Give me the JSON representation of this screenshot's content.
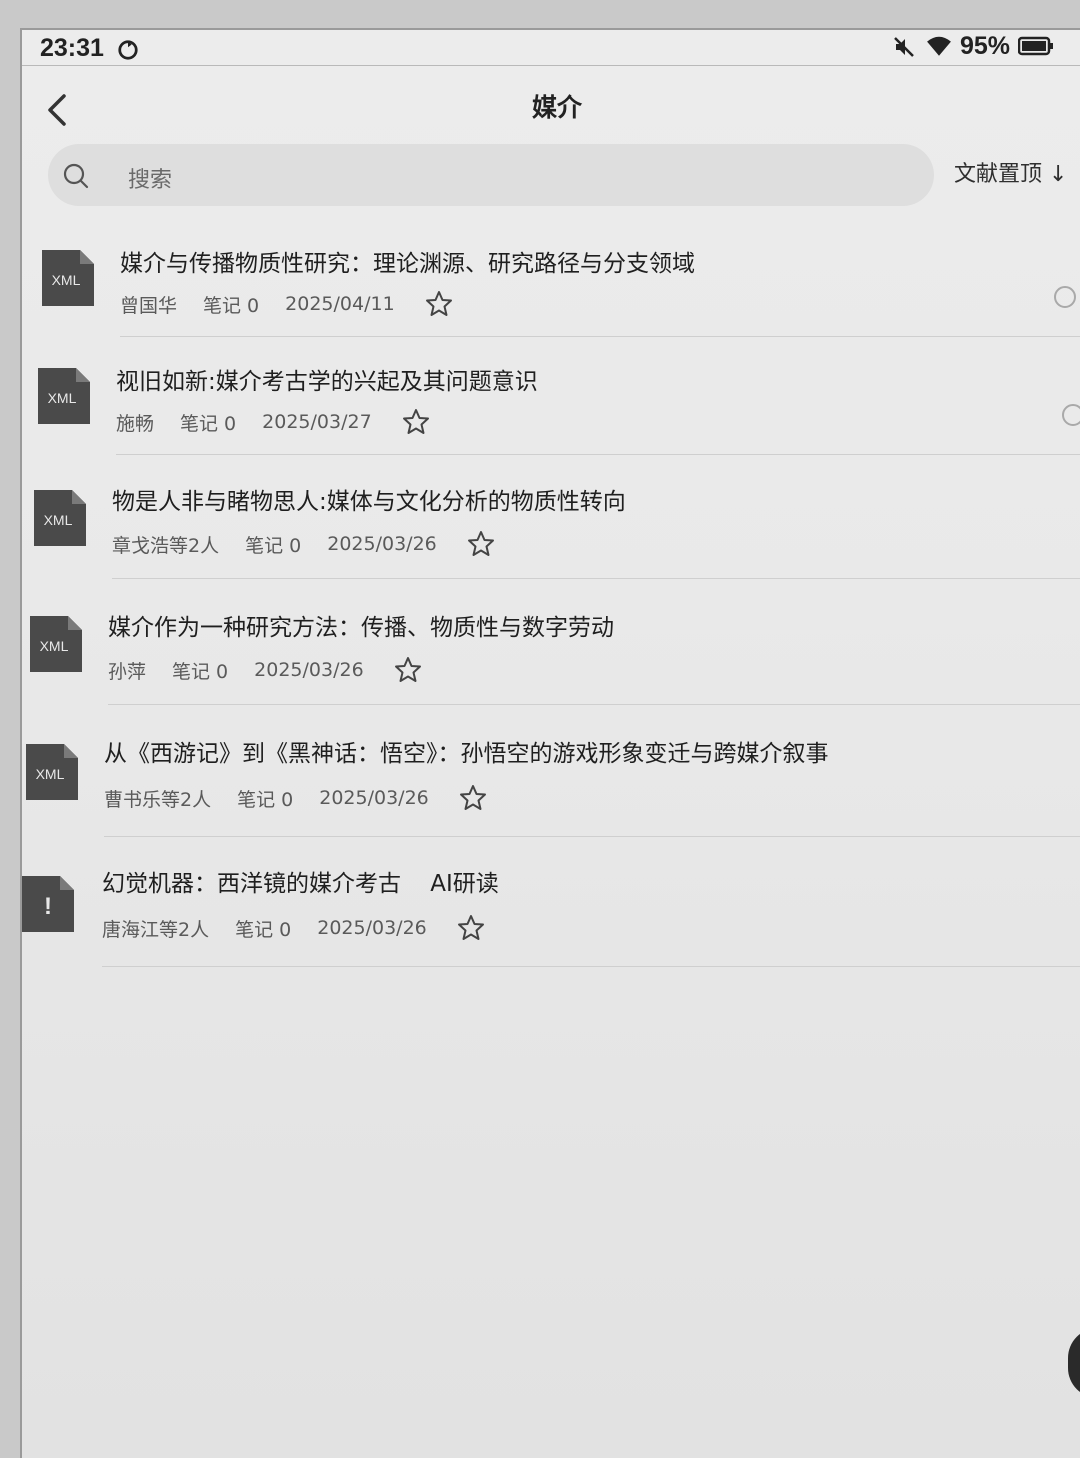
{
  "status_bar": {
    "time": "23:31",
    "battery": "95%",
    "icons": [
      "sync-icon",
      "mute-icon",
      "wifi-icon",
      "battery-icon"
    ]
  },
  "header": {
    "title": "媒介",
    "back_icon": "chevron-left-icon"
  },
  "search": {
    "placeholder": "搜索",
    "sort_label": "文献置顶 ↓"
  },
  "documents": [
    {
      "icon": "xml-file-icon",
      "icon_label": "XML",
      "title": "媒介与传播物质性研究：理论渊源、研究路径与分支领域",
      "author": "曾国华",
      "notes": "笔记 0",
      "date": "2025/04/11"
    },
    {
      "icon": "xml-file-icon",
      "icon_label": "XML",
      "title": "视旧如新:媒介考古学的兴起及其问题意识",
      "author": "施畅",
      "notes": "笔记 0",
      "date": "2025/03/27"
    },
    {
      "icon": "xml-file-icon",
      "icon_label": "XML",
      "title": "物是人非与睹物思人:媒体与文化分析的物质性转向",
      "author": "章戈浩等2人",
      "notes": "笔记 0",
      "date": "2025/03/26"
    },
    {
      "icon": "xml-file-icon",
      "icon_label": "XML",
      "title": "媒介作为一种研究方法：传播、物质性与数字劳动",
      "author": "孙萍",
      "notes": "笔记 0",
      "date": "2025/03/26"
    },
    {
      "icon": "xml-file-icon",
      "icon_label": "XML",
      "title": "从《西游记》到《黑神话：悟空》：孙悟空的游戏形象变迁与跨媒介叙事",
      "author": "曹书乐等2人",
      "notes": "笔记 0",
      "date": "2025/03/26"
    },
    {
      "icon": "warning-file-icon",
      "icon_label": "!",
      "title": "幻觉机器：西洋镜的媒介考古    AI研读",
      "author": "唐海江等2人",
      "notes": "笔记 0",
      "date": "2025/03/26"
    }
  ]
}
